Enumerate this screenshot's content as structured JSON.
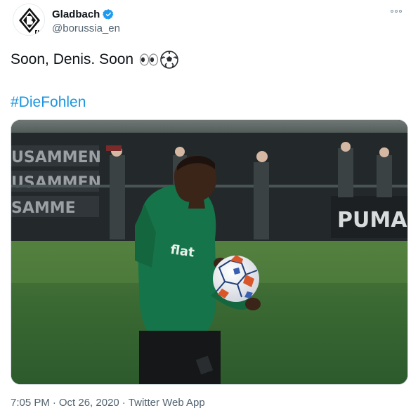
{
  "account": {
    "display_name": "Gladbach",
    "handle": "@borussia_en",
    "verified": true,
    "avatar_icon": "borussia-crest-icon"
  },
  "tweet": {
    "text": "Soon, Denis. Soon",
    "emojis": [
      "eyes-emoji",
      "soccer-ball-emoji"
    ],
    "hashtag": "#DieFohlen"
  },
  "media": {
    "description_icon": "photo",
    "banner_text": "PUMA"
  },
  "meta": {
    "time": "7:05 PM",
    "separator": "·",
    "date": "Oct 26, 2020",
    "source": "Twitter Web App"
  },
  "colors": {
    "hashtag": "#1b95e0",
    "verified": "#1d9bf0",
    "muted": "#536471"
  }
}
